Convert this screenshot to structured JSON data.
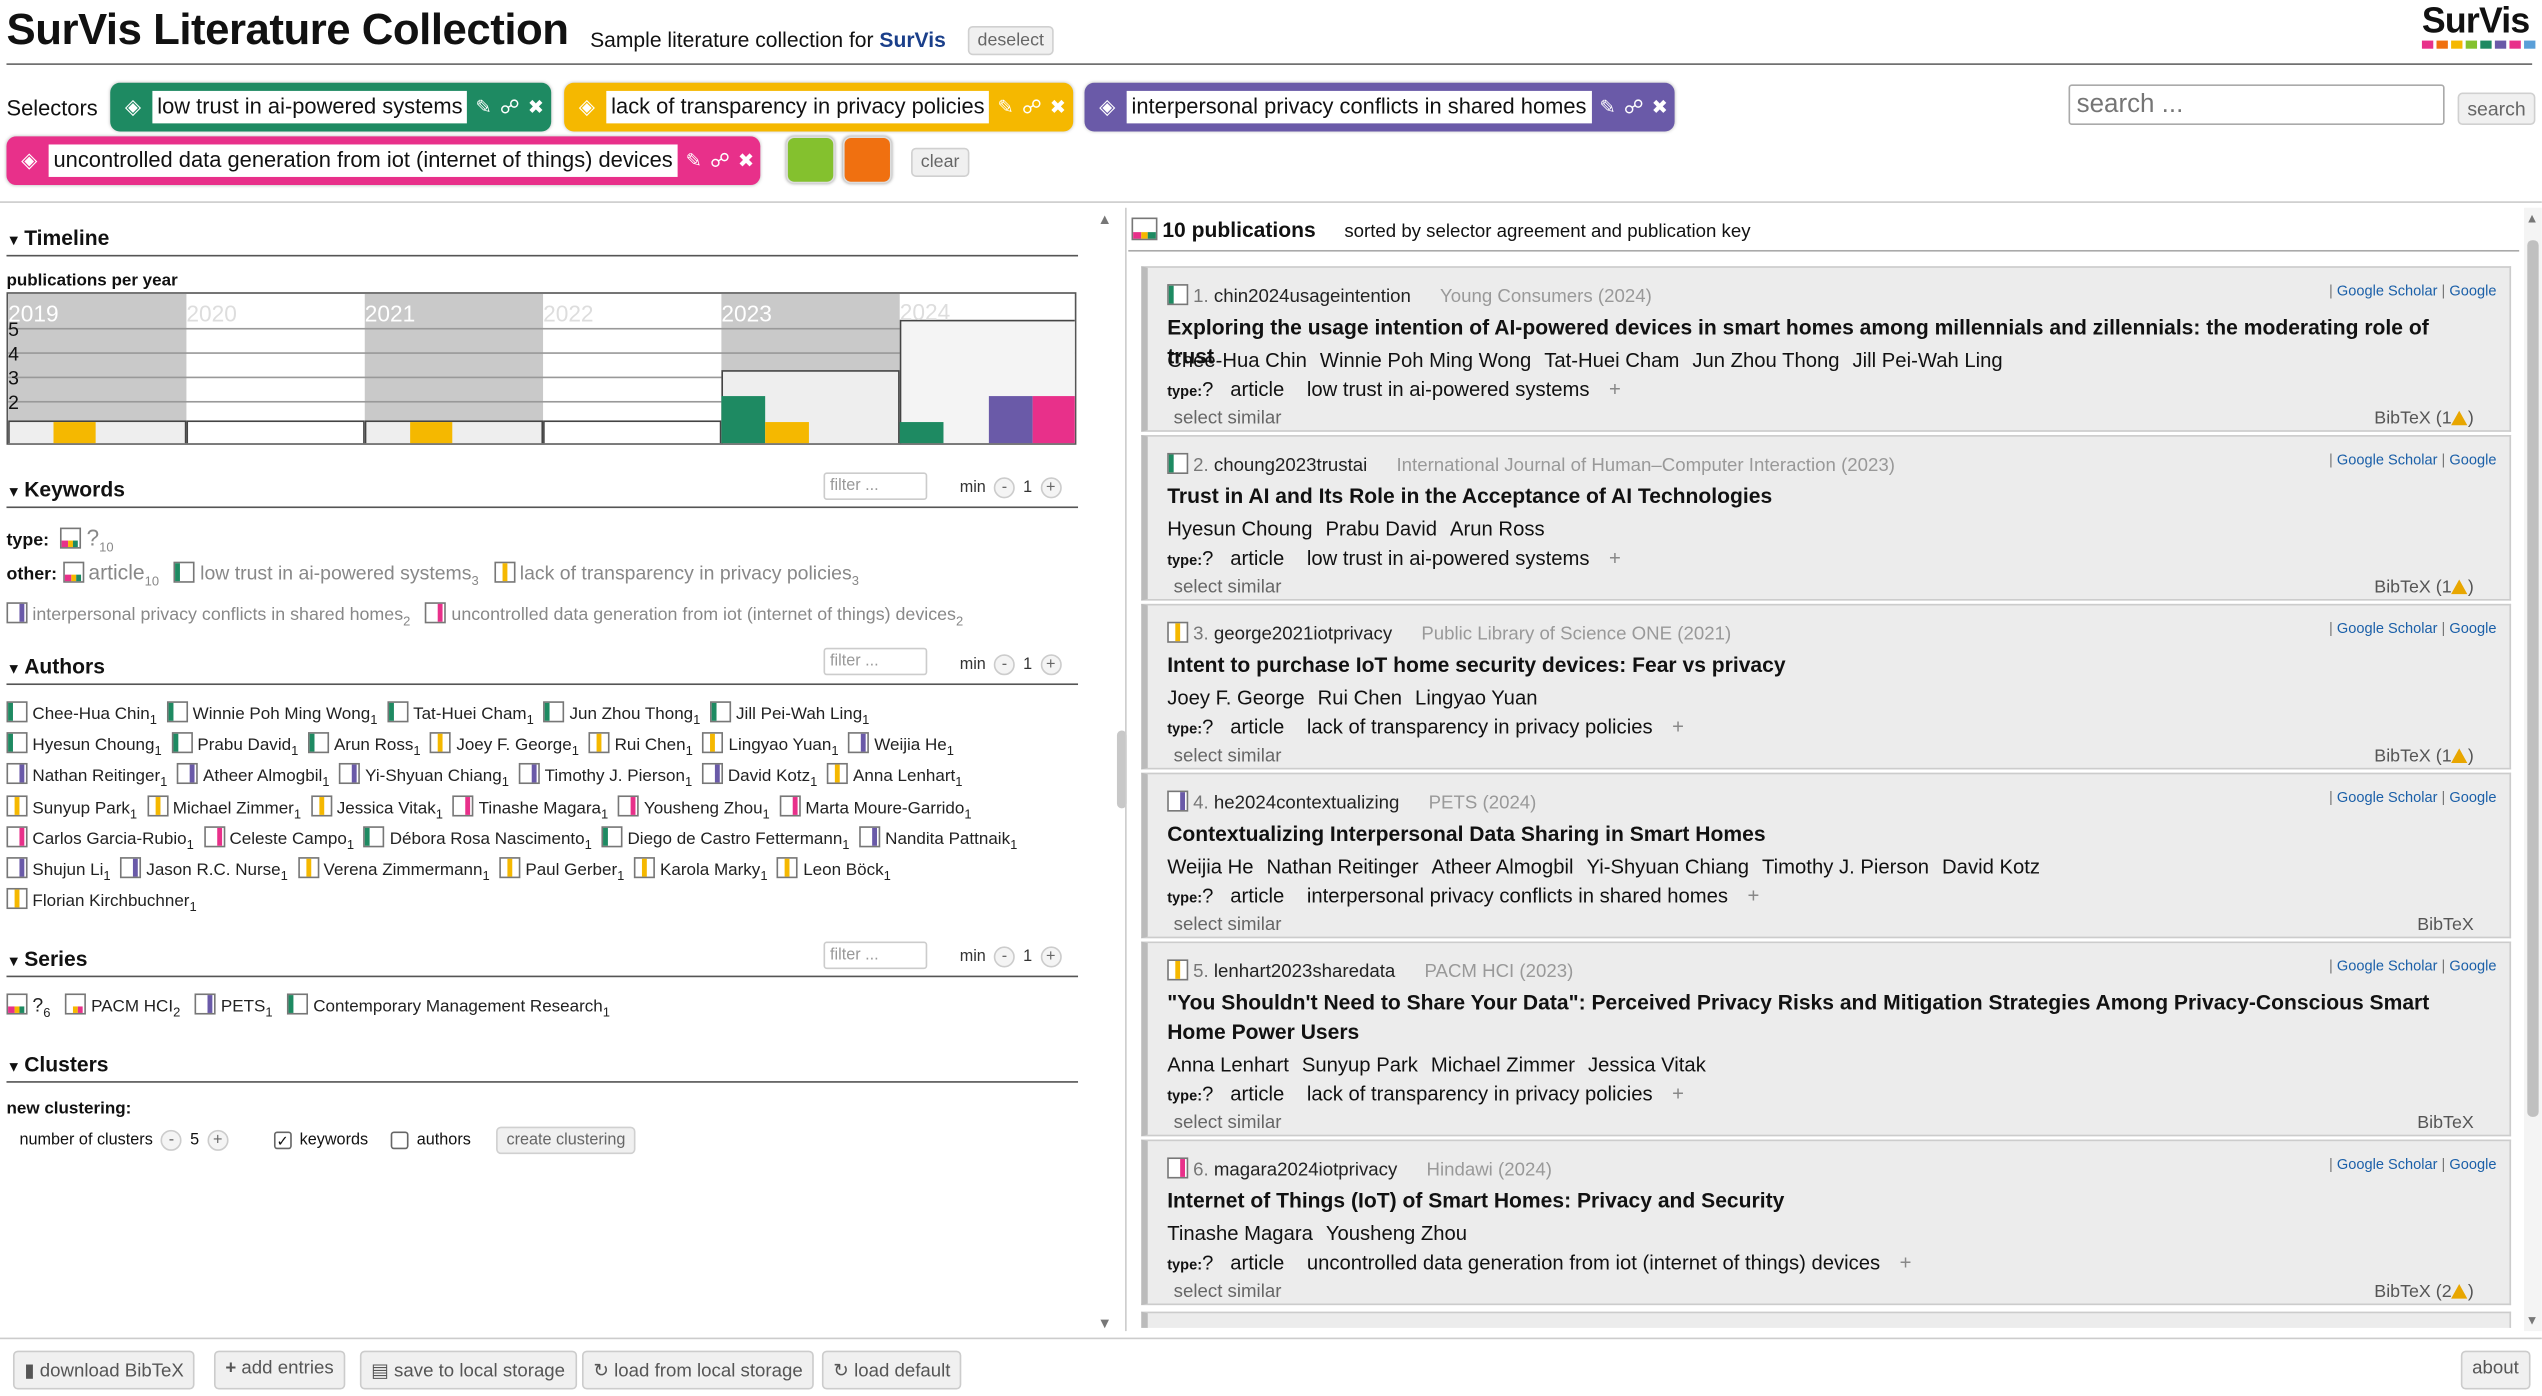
{
  "header": {
    "title": "SurVis Literature Collection",
    "subtitle": "Sample literature collection for ",
    "subtitle_brand": "SurVis",
    "deselect": "deselect",
    "logo": "SurVis"
  },
  "selectors": {
    "label": "Selectors",
    "items": [
      {
        "text": "low trust in ai-powered systems",
        "color": "#1e8a62"
      },
      {
        "text": "lack of transparency in privacy policies",
        "color": "#f5b800"
      },
      {
        "text": "interpersonal privacy conflicts in shared homes",
        "color": "#6a5aa8"
      },
      {
        "text": "uncontrolled data generation from iot (internet of things) devices",
        "color": "#e8308a"
      }
    ],
    "extra_colors": [
      "#84c12e",
      "#f07010"
    ],
    "clear": "clear"
  },
  "search": {
    "placeholder": "search ...",
    "button": "search"
  },
  "timeline": {
    "title": "Timeline",
    "subtitle": "publications per year",
    "years": [
      "2019",
      "2020",
      "2021",
      "2022",
      "2023",
      "2024"
    ],
    "ticks": [
      "5",
      "4",
      "3",
      "2"
    ]
  },
  "keywords": {
    "title": "Keywords",
    "filter": "filter ...",
    "min_label": "min",
    "min_value": "1",
    "type_label": "type:",
    "type_q": "?",
    "type_q_count": "10",
    "other_label": "other:",
    "items": [
      {
        "text": "article",
        "count": "10"
      },
      {
        "text": "low trust in ai-powered systems",
        "count": "3"
      },
      {
        "text": "lack of transparency in privacy policies",
        "count": "3"
      },
      {
        "text": "interpersonal privacy conflicts in shared homes",
        "count": "2"
      },
      {
        "text": "uncontrolled data generation from iot (internet of things) devices",
        "count": "2"
      }
    ]
  },
  "authors": {
    "title": "Authors",
    "filter": "filter ...",
    "min_label": "min",
    "min_value": "1",
    "rows": [
      [
        "Chee-Hua Chin",
        "Winnie Poh Ming Wong",
        "Tat-Huei Cham",
        "Jun Zhou Thong",
        "Jill Pei-Wah Ling"
      ],
      [
        "Hyesun Choung",
        "Prabu David",
        "Arun Ross",
        "Joey F. George",
        "Rui Chen",
        "Lingyao Yuan",
        "Weijia He"
      ],
      [
        "Nathan Reitinger",
        "Atheer Almogbil",
        "Yi-Shyuan Chiang",
        "Timothy J. Pierson",
        "David Kotz",
        "Anna Lenhart"
      ],
      [
        "Sunyup Park",
        "Michael Zimmer",
        "Jessica Vitak",
        "Tinashe Magara",
        "Yousheng Zhou",
        "Marta Moure-Garrido"
      ],
      [
        "Carlos Garcia-Rubio",
        "Celeste Campo",
        "Débora Rosa Nascimento",
        "Diego de Castro Fettermann",
        "Nandita Pattnaik"
      ],
      [
        "Shujun Li",
        "Jason R.C. Nurse",
        "Verena Zimmermann",
        "Paul Gerber",
        "Karola Marky",
        "Leon Böck"
      ],
      [
        "Florian Kirchbuchner"
      ]
    ],
    "count": "1"
  },
  "series": {
    "title": "Series",
    "filter": "filter ...",
    "min_label": "min",
    "min_value": "1",
    "items": [
      {
        "text": "?",
        "count": "6"
      },
      {
        "text": "PACM HCI",
        "count": "2"
      },
      {
        "text": "PETS",
        "count": "1"
      },
      {
        "text": "Contemporary Management Research",
        "count": "1"
      }
    ]
  },
  "clusters": {
    "title": "Clusters",
    "new": "new clustering:",
    "num_label": "number of clusters",
    "num_value": "5",
    "kw": "keywords",
    "au": "authors",
    "create": "create clustering"
  },
  "publications": {
    "count": "10 publications",
    "sort": "sorted by selector agreement and publication key",
    "scholar": "Google Scholar",
    "google": "Google",
    "select_similar": "select similar",
    "bibtex": "BibTeX",
    "type_label": "type:",
    "type_q": "?",
    "items": [
      {
        "num": "1.",
        "key": "chin2024usageintention",
        "venue": "Young Consumers",
        "year": "(2024)",
        "title": "Exploring the usage intention of AI-powered devices in smart homes among millennials and zillennials: the moderating role of trust",
        "authors": [
          "Chee-Hua Chin",
          "Winnie Poh Ming Wong",
          "Tat-Huei Cham",
          "Jun Zhou Thong",
          "Jill Pei-Wah Ling"
        ],
        "type": "article",
        "kw": "low trust in ai-powered systems",
        "warn": "(1",
        "warn_end": ")"
      },
      {
        "num": "2.",
        "key": "choung2023trustai",
        "venue": "International Journal of Human–Computer Interaction",
        "year": "(2023)",
        "title": "Trust in AI and Its Role in the Acceptance of AI Technologies",
        "authors": [
          "Hyesun Choung",
          "Prabu David",
          "Arun Ross"
        ],
        "type": "article",
        "kw": "low trust in ai-powered systems",
        "warn": "(1",
        "warn_end": ")"
      },
      {
        "num": "3.",
        "key": "george2021iotprivacy",
        "venue": "Public Library of Science ONE",
        "year": "(2021)",
        "title": "Intent to purchase IoT home security devices: Fear vs privacy",
        "authors": [
          "Joey F. George",
          "Rui Chen",
          "Lingyao Yuan"
        ],
        "type": "article",
        "kw": "lack of transparency in privacy policies",
        "warn": "(1",
        "warn_end": ")"
      },
      {
        "num": "4.",
        "key": "he2024contextualizing",
        "venue": "PETS",
        "year": "(2024)",
        "title": "Contextualizing Interpersonal Data Sharing in Smart Homes",
        "authors": [
          "Weijia He",
          "Nathan Reitinger",
          "Atheer Almogbil",
          "Yi-Shyuan Chiang",
          "Timothy J. Pierson",
          "David Kotz"
        ],
        "type": "article",
        "kw": "interpersonal privacy conflicts in shared homes",
        "warn": "",
        "warn_end": ""
      },
      {
        "num": "5.",
        "key": "lenhart2023sharedata",
        "venue": "PACM HCI",
        "year": "(2023)",
        "title": "\"You Shouldn't Need to Share Your Data\": Perceived Privacy Risks and Mitigation Strategies Among Privacy-Conscious Smart Home Power Users",
        "authors": [
          "Anna Lenhart",
          "Sunyup Park",
          "Michael Zimmer",
          "Jessica Vitak"
        ],
        "type": "article",
        "kw": "lack of transparency in privacy policies",
        "warn": "",
        "warn_end": ""
      },
      {
        "num": "6.",
        "key": "magara2024iotprivacy",
        "venue": "Hindawi",
        "year": "(2024)",
        "title": "Internet of Things (IoT) of Smart Homes: Privacy and Security",
        "authors": [
          "Tinashe Magara",
          "Yousheng Zhou"
        ],
        "type": "article",
        "kw": "uncontrolled data generation from iot (internet of things) devices",
        "warn": "(2",
        "warn_end": ")"
      }
    ]
  },
  "footer": {
    "download": "download BibTeX",
    "add": "add entries",
    "save": "save to local storage",
    "load": "load from local storage",
    "default": "load default",
    "about": "about"
  }
}
